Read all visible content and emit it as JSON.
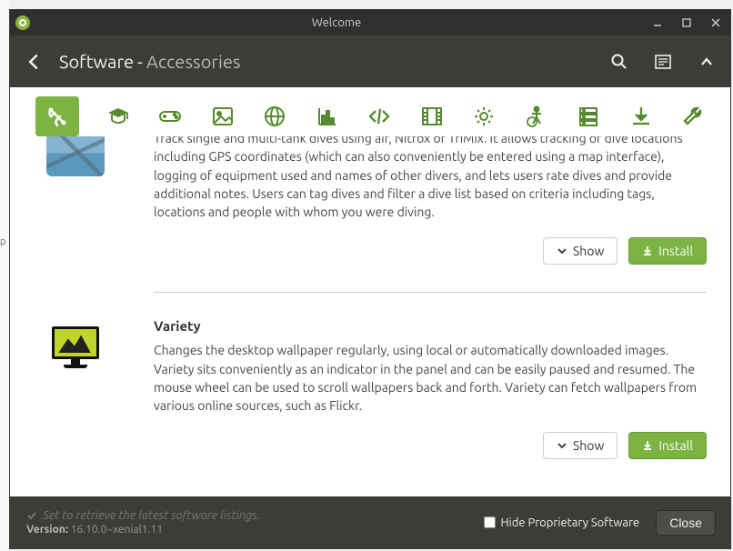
{
  "titlebar": {
    "title": "Welcome"
  },
  "toolbar": {
    "crumb_main": "Software",
    "crumb_sep": "-",
    "crumb_sub": "Accessories"
  },
  "categories": [
    "accessories-icon",
    "education-icon",
    "games-icon",
    "graphics-icon",
    "internet-icon",
    "office-icon",
    "programming-icon",
    "video-icon",
    "system-icon",
    "accessibility-icon",
    "servers-icon",
    "downloads-icon",
    "tools-icon"
  ],
  "apps": [
    {
      "id": "subsurface",
      "title": "",
      "description": "Track single and multi-tank dives using air, Nitrox or TriMix. It allows tracking of dive locations including GPS coordinates (which can also conveniently be entered using a map interface), logging of equipment used and names of other divers, and lets users rate dives and provide additional notes. Users can tag dives and filter a dive list based on criteria including tags, locations and people with whom you were diving.",
      "show_label": "Show",
      "install_label": "Install"
    },
    {
      "id": "variety",
      "title": "Variety",
      "description": "Changes the desktop wallpaper regularly, using local or automatically downloaded images. Variety sits conveniently as an indicator in the panel and can be easily paused and resumed. The mouse wheel can be used to scroll wallpapers back and forth. Variety can fetch wallpapers from various online sources, such as Flickr.",
      "show_label": "Show",
      "install_label": "Install"
    }
  ],
  "statusbar": {
    "listing_status": "Set to retrieve the latest software listings.",
    "version_label": "Version:",
    "version_value": "16.10.0~xenial1.11",
    "hide_proprietary_label": "Hide Proprietary Software",
    "close_label": "Close"
  }
}
